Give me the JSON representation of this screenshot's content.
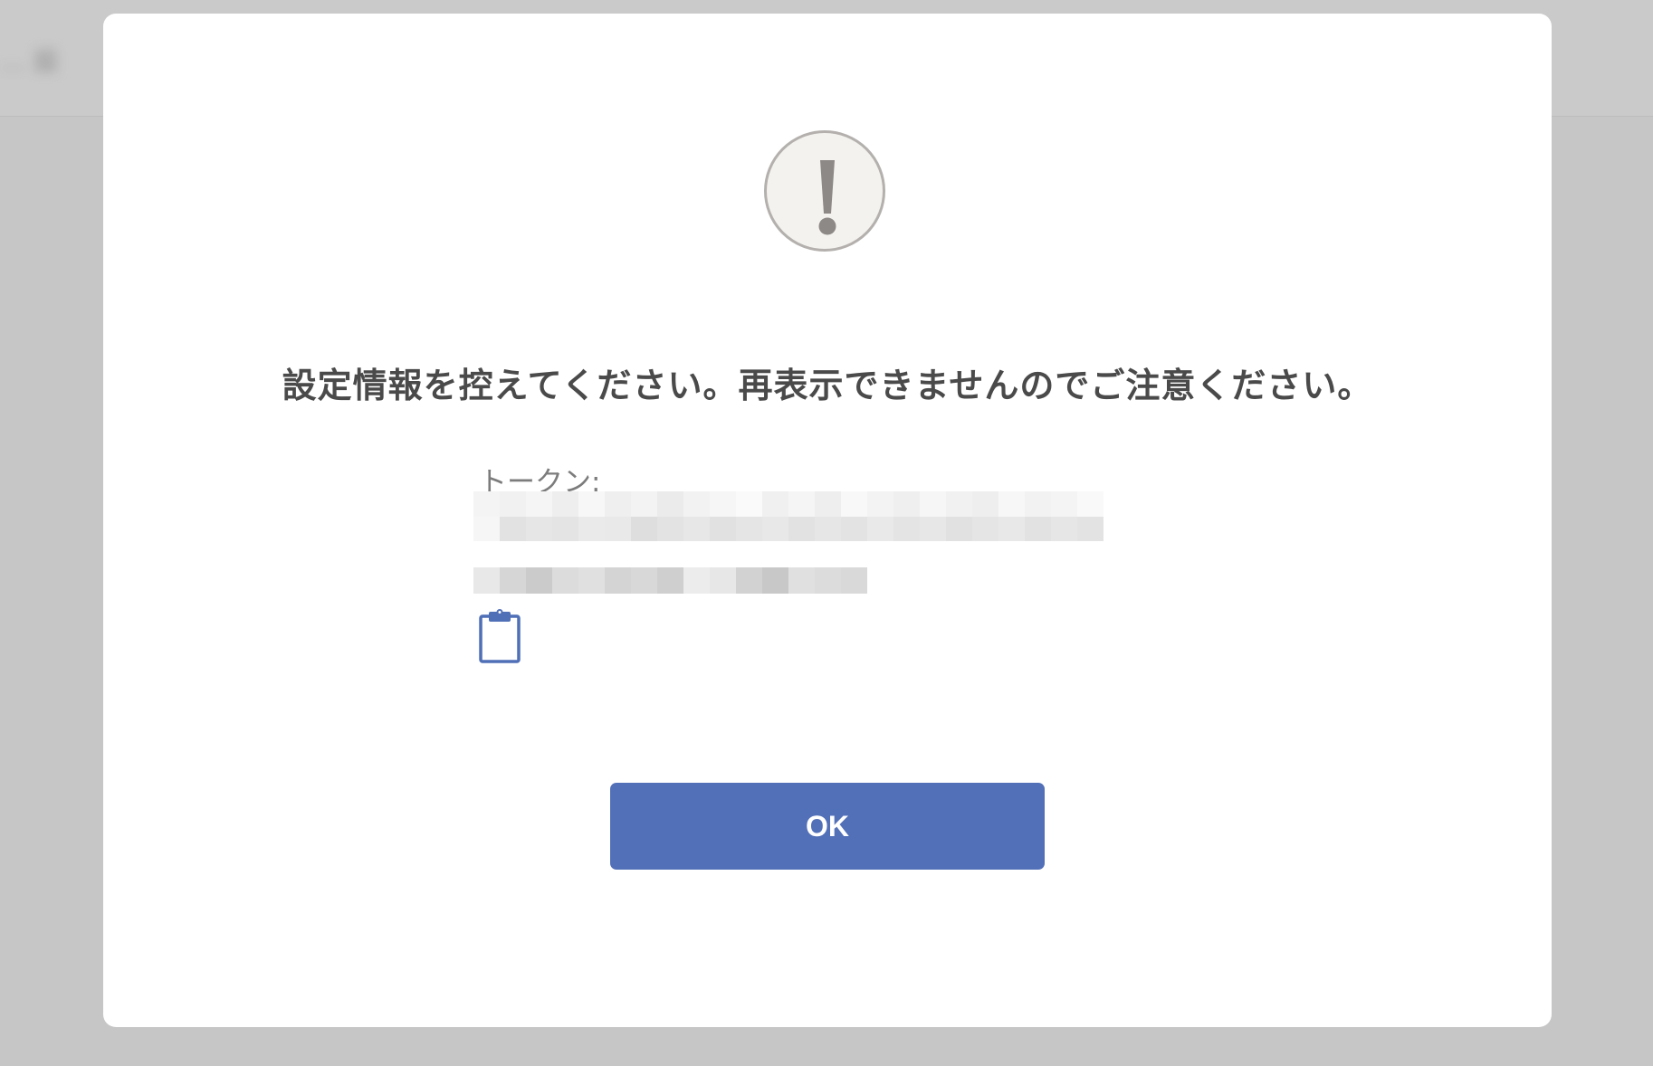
{
  "background": {
    "header_text": "… 設"
  },
  "dialog": {
    "message": "設定情報を控えてください。再表示できませんのでご注意ください。",
    "token_label": "トークン:",
    "token_value_redacted": true,
    "copy_icon": "clipboard-icon",
    "ok_label": "OK"
  },
  "colors": {
    "overlay": "#c6c6c6",
    "dialog_bg": "#ffffff",
    "message_text": "#4a4a4a",
    "label_text": "#7c7c7c",
    "primary_button": "#5270b8",
    "icon_blue": "#4f6fb6",
    "warning_icon_bg": "#f3f2ef",
    "warning_icon_border": "#b3b0ad",
    "warning_icon_mark": "#8d8986"
  }
}
